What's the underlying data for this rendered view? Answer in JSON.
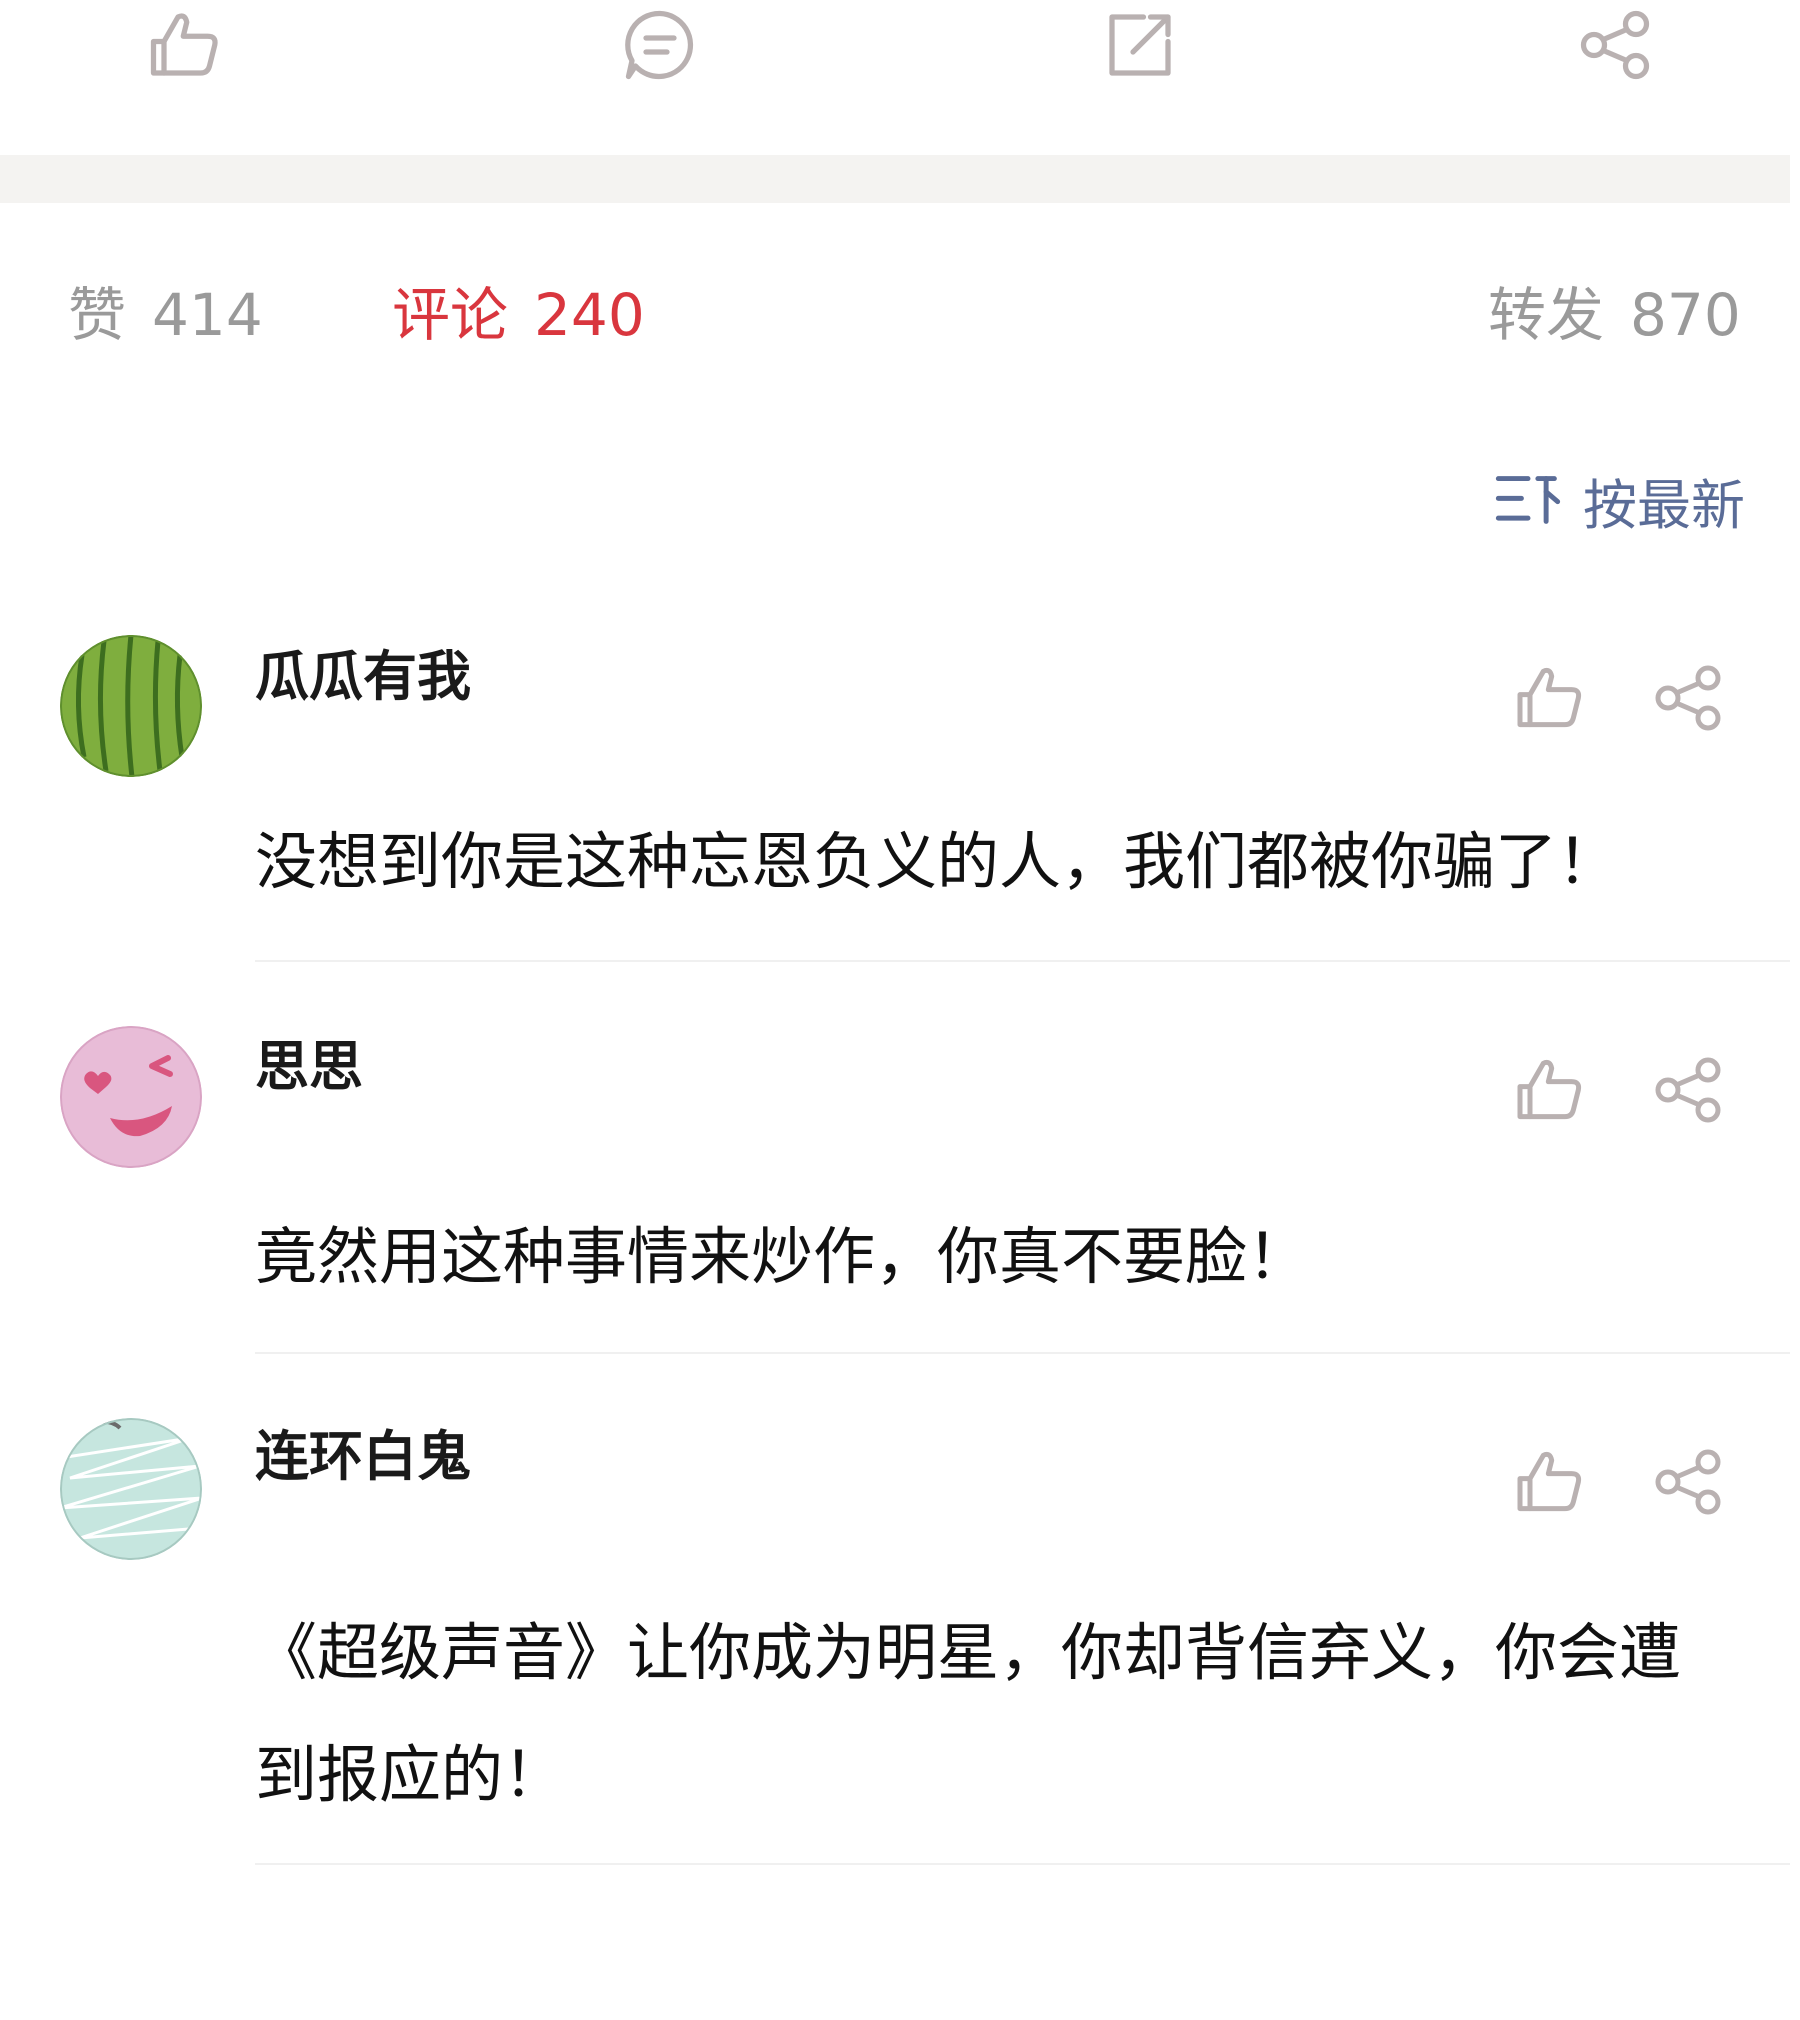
{
  "action_bar": {
    "icons": [
      "thumbs-up-icon",
      "comment-icon",
      "repost-icon",
      "share-icon"
    ]
  },
  "counts": {
    "likes_label": "赞",
    "likes_count": "414",
    "comments_label": "评论",
    "comments_count": "240",
    "reposts_label": "转发",
    "reposts_count": "870"
  },
  "sort": {
    "label": "按最新",
    "icon": "sort-icon"
  },
  "colors": {
    "active_tab": "#d9363e",
    "inactive_tab": "#9a9a9a",
    "sort_blue": "#5a6c97",
    "icon_gray": "#b9b1b1",
    "band": "#f4f3f1"
  },
  "comments": [
    {
      "username": "瓜瓜有我",
      "avatar": "watermelon-avatar",
      "text": "没想到你是这种忘恩负义的人，我们都被你骗了！"
    },
    {
      "username": "思思",
      "avatar": "wink-face-avatar",
      "text": "竟然用这种事情来炒作，你真不要脸！"
    },
    {
      "username": "连环白鬼",
      "avatar": "mint-pattern-avatar",
      "text": "《超级声音》让你成为明星，你却背信弃义，你会遭到报应的！"
    }
  ]
}
